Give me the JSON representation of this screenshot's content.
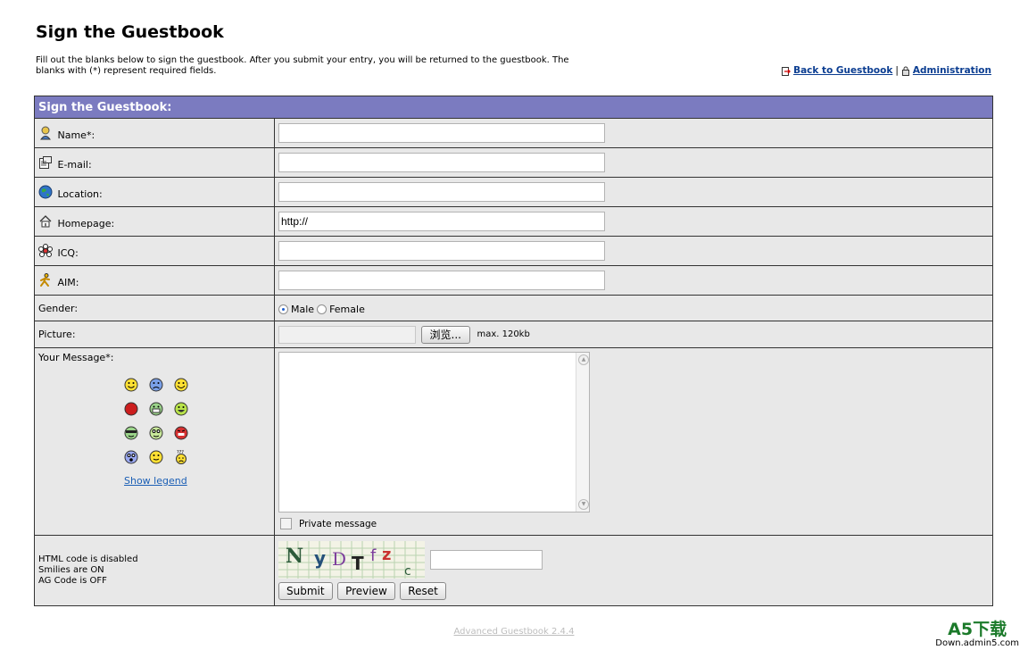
{
  "page": {
    "title": "Sign the Guestbook",
    "intro": "Fill out the blanks below to sign the guestbook. After you submit your entry, you will be returned to the guestbook. The blanks with (*) represent required fields."
  },
  "links": {
    "back": "Back to Guestbook",
    "separator": "|",
    "admin": "Administration"
  },
  "form": {
    "header": "Sign the Guestbook:",
    "fields": {
      "name": {
        "label": "Name*:",
        "value": "",
        "icon": "person-icon"
      },
      "email": {
        "label": "E-mail:",
        "value": "",
        "icon": "email-icon"
      },
      "location": {
        "label": "Location:",
        "value": "",
        "icon": "globe-icon"
      },
      "homepage": {
        "label": "Homepage:",
        "value": "http://",
        "icon": "home-icon"
      },
      "icq": {
        "label": "ICQ:",
        "value": "",
        "icon": "icq-flower-icon"
      },
      "aim": {
        "label": "AIM:",
        "value": "",
        "icon": "aim-runner-icon"
      }
    },
    "gender": {
      "label": "Gender:",
      "options": [
        "Male",
        "Female"
      ],
      "selected": "Male"
    },
    "picture": {
      "label": "Picture:",
      "browse": "浏览...",
      "max_size": "max. 120kb"
    },
    "message": {
      "label": "Your Message*:",
      "value": "",
      "show_legend": "Show legend",
      "private": "Private message",
      "smilies": [
        "smile",
        "frown",
        "grin",
        "angry",
        "teeth",
        "laugh",
        "cool",
        "wink",
        "mad",
        "eek",
        "smile2",
        "confused"
      ]
    },
    "status": {
      "html": "HTML code is disabled",
      "smilies": "Smilies are ON",
      "ag": "AG Code is OFF"
    },
    "captcha": {
      "text": "NyDTfzc",
      "value": ""
    },
    "buttons": {
      "submit": "Submit",
      "preview": "Preview",
      "reset": "Reset"
    }
  },
  "footer": {
    "version": "Advanced Guestbook 2.4.4"
  },
  "watermark": {
    "brand": "A5下载",
    "site": "Down.admin5.com"
  },
  "colors": {
    "header_bg": "#7b7bc0",
    "row_bg": "#e8e8e8",
    "link": "#0b3d91"
  }
}
